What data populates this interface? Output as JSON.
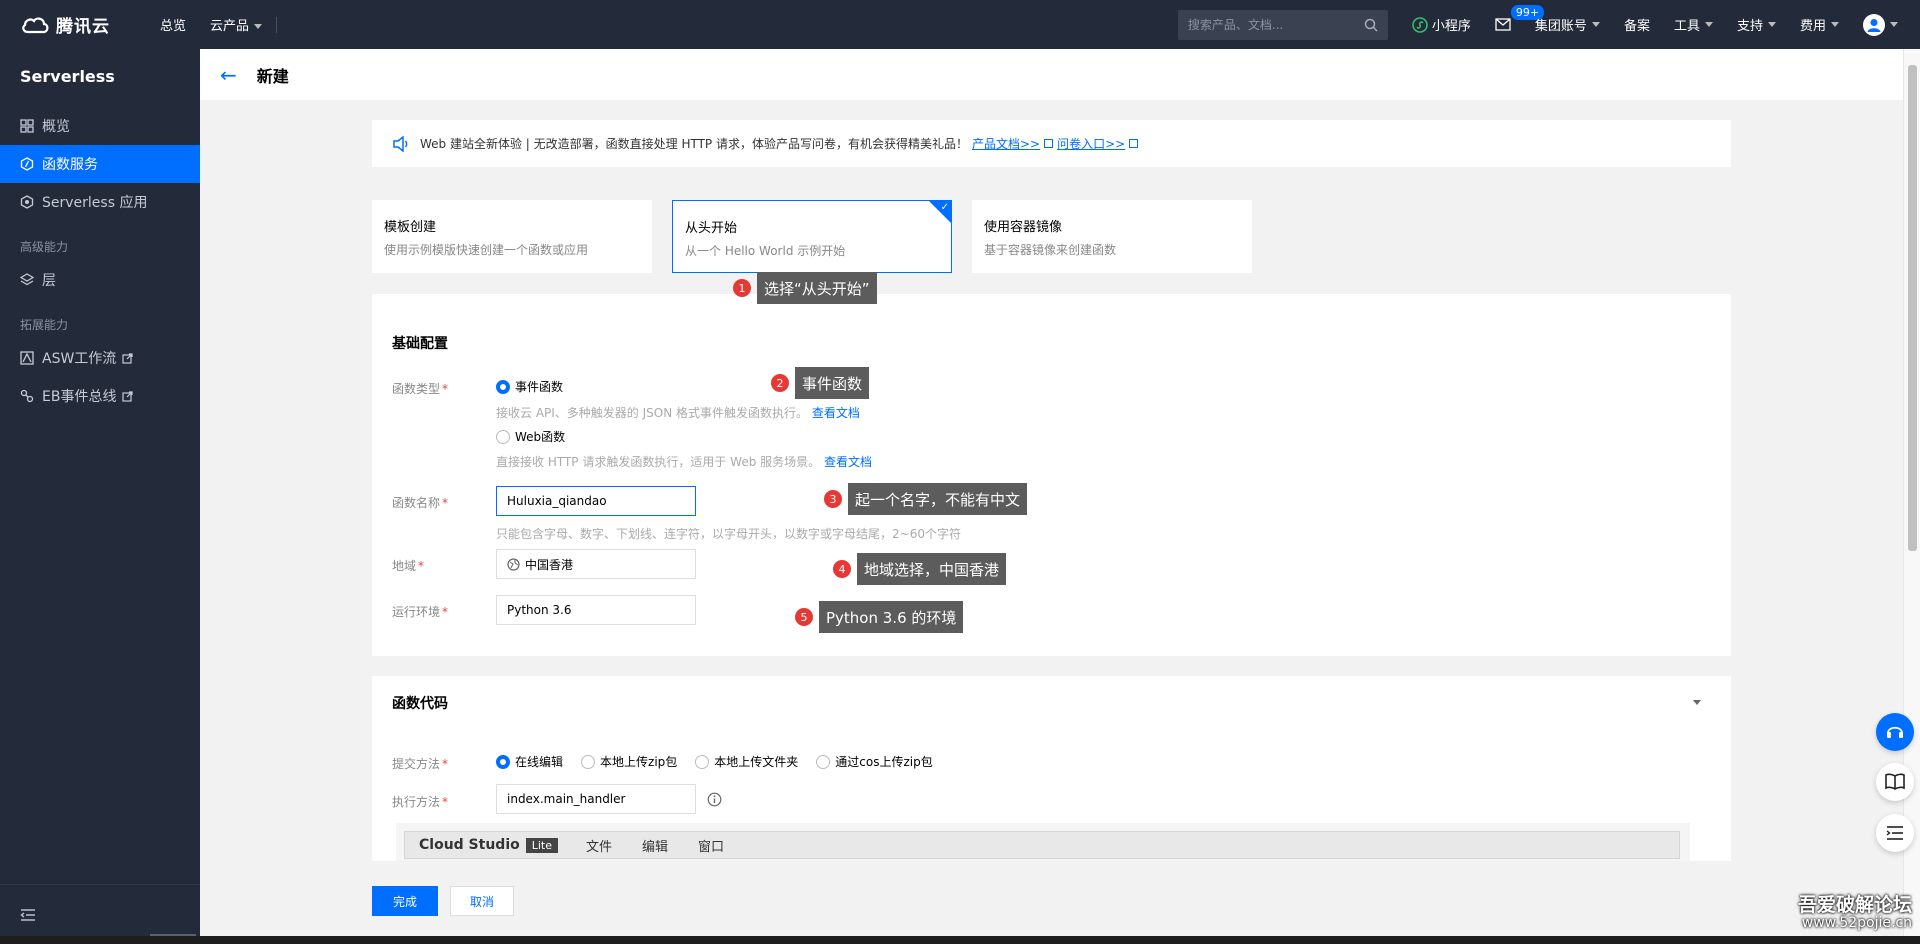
{
  "topbar": {
    "brand": "腾讯云",
    "nav": [
      "总览",
      "云产品"
    ],
    "search_placeholder": "搜索产品、文档...",
    "mini_program": "小程序",
    "mail_badge": "99+",
    "right_items": [
      "集团账号",
      "备案",
      "工具",
      "支持",
      "费用"
    ]
  },
  "sidebar": {
    "title": "Serverless",
    "items": [
      {
        "label": "概览",
        "icon": "grid-icon"
      },
      {
        "label": "函数服务",
        "icon": "function-icon"
      },
      {
        "label": "Serverless 应用",
        "icon": "hexagon-icon"
      }
    ],
    "group_advanced": "高级能力",
    "layer": "层",
    "group_extend": "拓展能力",
    "ext_items": [
      "ASW工作流",
      "EB事件总线"
    ]
  },
  "page": {
    "title": "新建",
    "notice": {
      "text": "Web 建站全新体验 | 无改造部署，函数直接处理 HTTP 请求，体验产品写问卷，有机会获得精美礼品！",
      "link1": "产品文档>>",
      "link2": "问卷入口>>"
    },
    "cards": [
      {
        "title": "模板创建",
        "desc": "使用示例模版快速创建一个函数或应用"
      },
      {
        "title": "从头开始",
        "desc": "从一个 Hello World 示例开始"
      },
      {
        "title": "使用容器镜像",
        "desc": "基于容器镜像来创建函数"
      }
    ],
    "basic": {
      "title": "基础配置",
      "func_type_label": "函数类型",
      "event_func": "事件函数",
      "event_help": "接收云 API、多种触发器的 JSON 格式事件触发函数执行。",
      "web_func": "Web函数",
      "web_help": "直接接收 HTTP 请求触发函数执行，适用于 Web 服务场景。",
      "doc_link": "查看文档",
      "name_label": "函数名称",
      "name_value": "Huluxia_qiandao",
      "name_help": "只能包含字母、数字、下划线、连字符，以字母开头，以数字或字母结尾，2~60个字符",
      "region_label": "地域",
      "region_value": "中国香港",
      "runtime_label": "运行环境",
      "runtime_value": "Python 3.6"
    },
    "code": {
      "title": "函数代码",
      "submit_label": "提交方法",
      "submit_options": [
        "在线编辑",
        "本地上传zip包",
        "本地上传文件夹",
        "通过cos上传zip包"
      ],
      "handler_label": "执行方法",
      "handler_value": "index.main_handler",
      "editor_title": "Cloud Studio",
      "editor_badge": "Lite",
      "editor_menu": [
        "文件",
        "编辑",
        "窗口"
      ]
    },
    "buttons": {
      "done": "完成",
      "cancel": "取消"
    }
  },
  "annotations": [
    {
      "num": "1",
      "text": "选择“从头开始”"
    },
    {
      "num": "2",
      "text": "事件函数"
    },
    {
      "num": "3",
      "text": "起一个名字，不能有中文"
    },
    {
      "num": "4",
      "text": "地域选择，中国香港"
    },
    {
      "num": "5",
      "text": "Python 3.6 的环境"
    }
  ],
  "watermark": {
    "line1": "吾爱破解论坛",
    "line2": "www.52pojie.cn"
  },
  "colors": {
    "accent": "#006eff",
    "nav_bg": "#232a39",
    "tip_bg": "#5c5c5c",
    "tip_num": "#e53935"
  }
}
